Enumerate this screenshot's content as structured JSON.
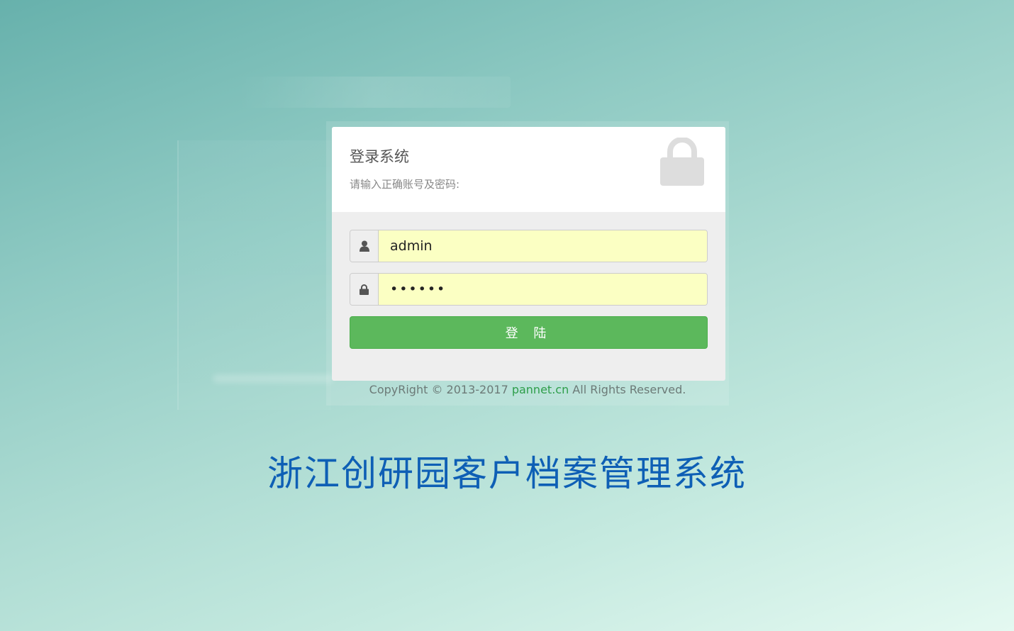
{
  "login": {
    "heading": "登录系统",
    "subheading": "请输入正确账号及密码:",
    "username_value": "admin",
    "password_value": "123456",
    "submit_label": "登 陆"
  },
  "footer": {
    "prefix": "CopyRight © 2013-2017 ",
    "brand": "pannet.cn",
    "suffix": " All Rights Reserved."
  },
  "system_title": "浙江创研园客户档案管理系统",
  "icons": {
    "header": "lock-icon",
    "username": "user-icon",
    "password": "lock-icon"
  },
  "colors": {
    "login_button": "#5cb85c",
    "input_bg": "#fbffc3",
    "brand_link": "#2e9e4a",
    "system_title": "#0e5fb5"
  }
}
